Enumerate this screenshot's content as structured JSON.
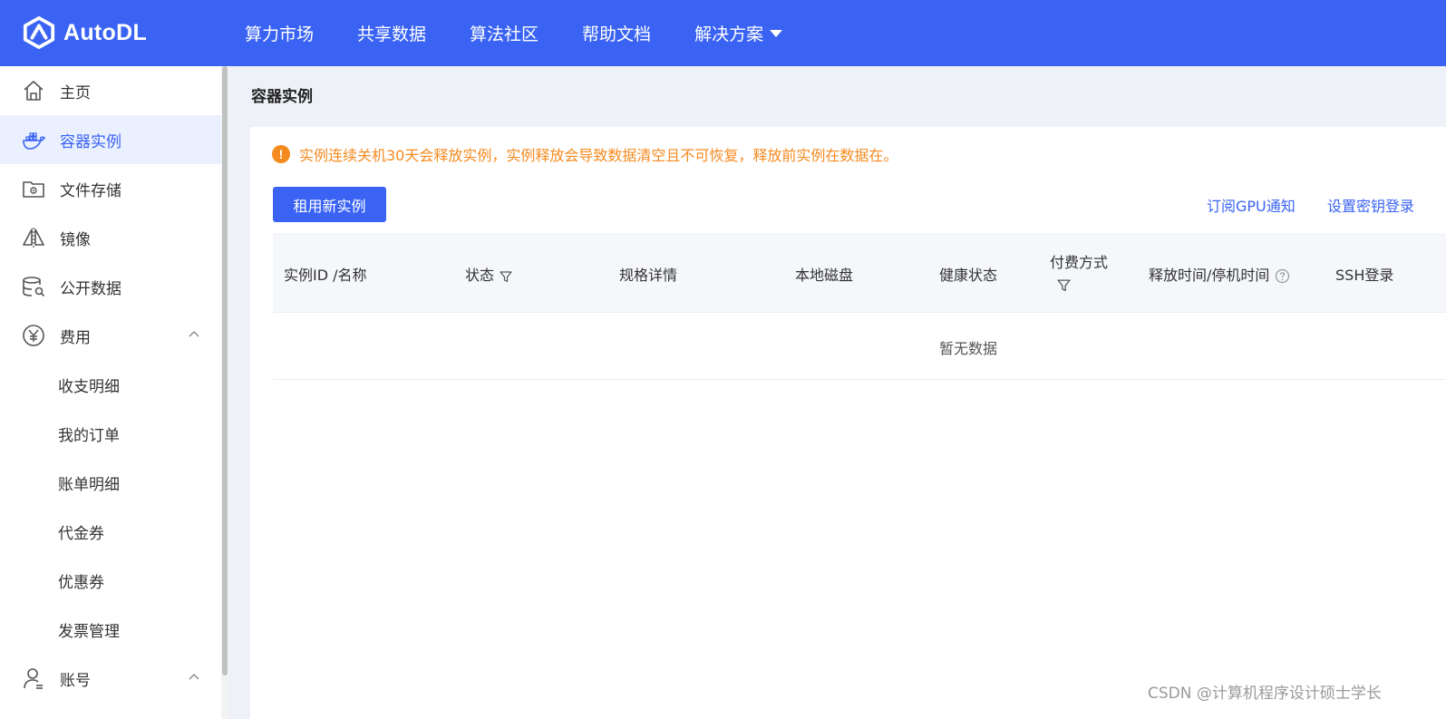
{
  "brand": {
    "name": "AutoDL"
  },
  "nav": {
    "items": [
      {
        "label": "算力市场"
      },
      {
        "label": "共享数据"
      },
      {
        "label": "算法社区"
      },
      {
        "label": "帮助文档"
      },
      {
        "label": "解决方案"
      }
    ]
  },
  "sidebar": {
    "items": [
      {
        "label": "主页",
        "icon": "home-icon"
      },
      {
        "label": "容器实例",
        "icon": "docker-icon",
        "active": true
      },
      {
        "label": "文件存储",
        "icon": "folder-gear-icon"
      },
      {
        "label": "镜像",
        "icon": "mirror-icon"
      },
      {
        "label": "公开数据",
        "icon": "database-search-icon"
      },
      {
        "label": "费用",
        "icon": "yen-icon",
        "expanded": true
      },
      {
        "label": "收支明细"
      },
      {
        "label": "我的订单"
      },
      {
        "label": "账单明细"
      },
      {
        "label": "代金券"
      },
      {
        "label": "优惠券"
      },
      {
        "label": "发票管理"
      },
      {
        "label": "账号",
        "icon": "user-icon",
        "expanded": true
      }
    ]
  },
  "main": {
    "title": "容器实例",
    "warning": "实例连续关机30天会释放实例，实例释放会导致数据清空且不可恢复，释放前实例在数据在。",
    "new_button": "租用新实例",
    "links": {
      "subscribe": "订阅GPU通知",
      "ssh_key": "设置密钥登录"
    },
    "table": {
      "columns": [
        "实例ID /名称",
        "状态",
        "规格详情",
        "本地磁盘",
        "健康状态",
        "付费方式",
        "释放时间/停机时间",
        "SSH登录"
      ],
      "empty_text": "暂无数据"
    }
  },
  "watermark": "CSDN @计算机程序设计硕士学长",
  "colors": {
    "primary": "#3a63f3",
    "warning": "#f58a1f",
    "active_bg": "#eaf0fe"
  }
}
